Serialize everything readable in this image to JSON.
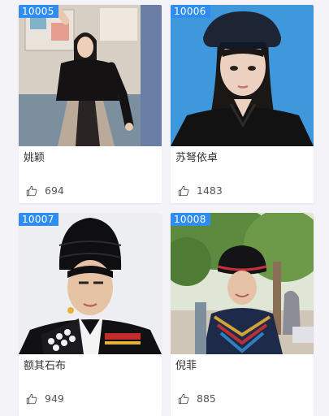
{
  "cards": [
    {
      "id": "10005",
      "name": "姚颖",
      "likes": "694"
    },
    {
      "id": "10006",
      "name": "苏弩依卓",
      "likes": "1483"
    },
    {
      "id": "10007",
      "name": "额其石布",
      "likes": "949"
    },
    {
      "id": "10008",
      "name": "倪菲",
      "likes": "885"
    }
  ],
  "colors": {
    "badge": "#2f8df0",
    "background": "#f4f3f8"
  },
  "icons": {
    "like": "thumbs-up-icon"
  }
}
